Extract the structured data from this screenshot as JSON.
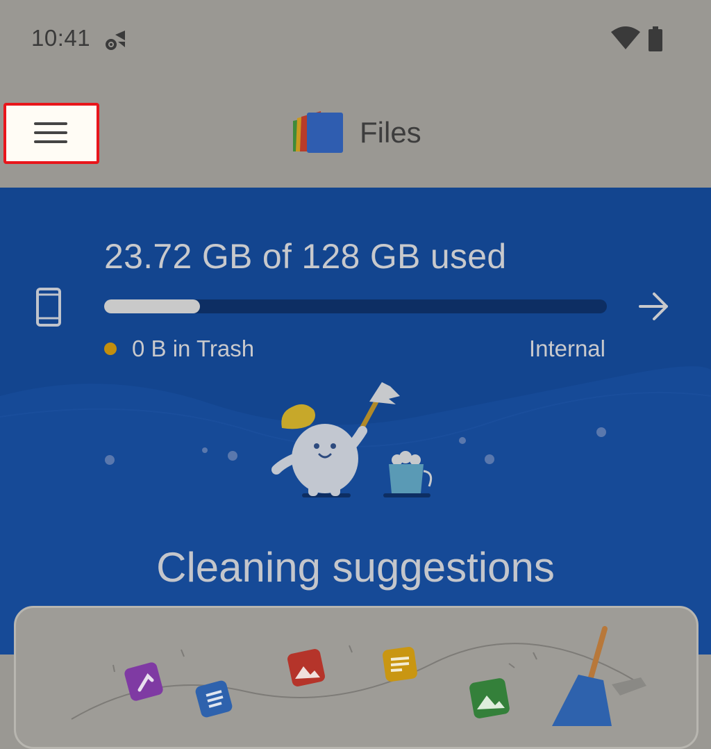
{
  "status_bar": {
    "time": "10:41",
    "icons": [
      "gear-signal-icon",
      "wifi-icon",
      "battery-icon"
    ]
  },
  "app_bar": {
    "menu_icon": "hamburger-menu-icon",
    "title": "Files",
    "logo_icon": "files-logo-icon"
  },
  "storage": {
    "used_text": "23.72 GB of 128 GB used",
    "used_gb": 23.72,
    "total_gb": 128,
    "trash_text": "0 B in Trash",
    "location_label": "Internal",
    "device_icon": "phone-icon",
    "arrow_icon": "arrow-right-icon"
  },
  "cleaning": {
    "title": "Cleaning suggestions",
    "illustration": "cleaning-mascot-illustration"
  },
  "colors": {
    "hero_bg": "#13458f",
    "scrim_bg": "#9a9893",
    "highlight": "#e8161b",
    "trash_dot": "#c28e0e"
  }
}
